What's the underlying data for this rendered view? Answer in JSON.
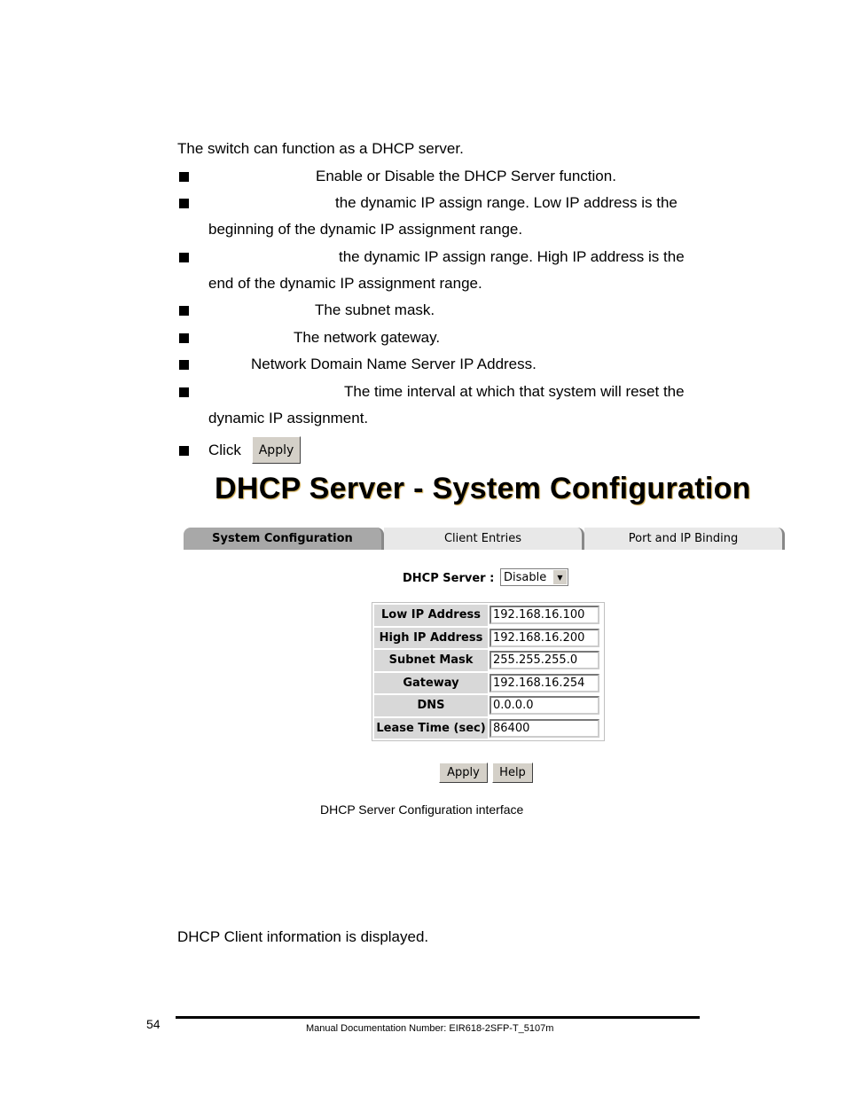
{
  "intro": "The switch can function as a DHCP server.",
  "bullets": [
    "Enable or Disable the DHCP Server function.",
    "the dynamic IP assign range. Low IP address is the",
    "beginning of the dynamic IP assignment range.",
    "the dynamic IP assign range. High IP address is the",
    "end of the dynamic IP assignment range.",
    "The subnet mask.",
    "The network gateway.",
    "Network Domain Name Server IP Address.",
    "The time interval at which that system will reset the",
    "dynamic IP assignment."
  ],
  "click_text": "Click",
  "click_button": "Apply",
  "ui": {
    "title": "DHCP Server - System Configuration",
    "tabs": [
      "System Configuration",
      "Client Entries",
      "Port and IP Binding"
    ],
    "dhcp_server_label": "DHCP Server :",
    "dhcp_server_value": "Disable",
    "fields": [
      {
        "label": "Low IP Address",
        "value": "192.168.16.100"
      },
      {
        "label": "High IP Address",
        "value": "192.168.16.200"
      },
      {
        "label": "Subnet Mask",
        "value": "255.255.255.0"
      },
      {
        "label": "Gateway",
        "value": "192.168.16.254"
      },
      {
        "label": "DNS",
        "value": "0.0.0.0"
      },
      {
        "label": "Lease Time (sec)",
        "value": "86400"
      }
    ],
    "apply": "Apply",
    "help": "Help"
  },
  "caption": "DHCP Server Configuration interface",
  "client_info": "DHCP Client information is displayed.",
  "page_number": "54",
  "footer": "Manual Documentation Number: EIR618-2SFP-T_5107m"
}
